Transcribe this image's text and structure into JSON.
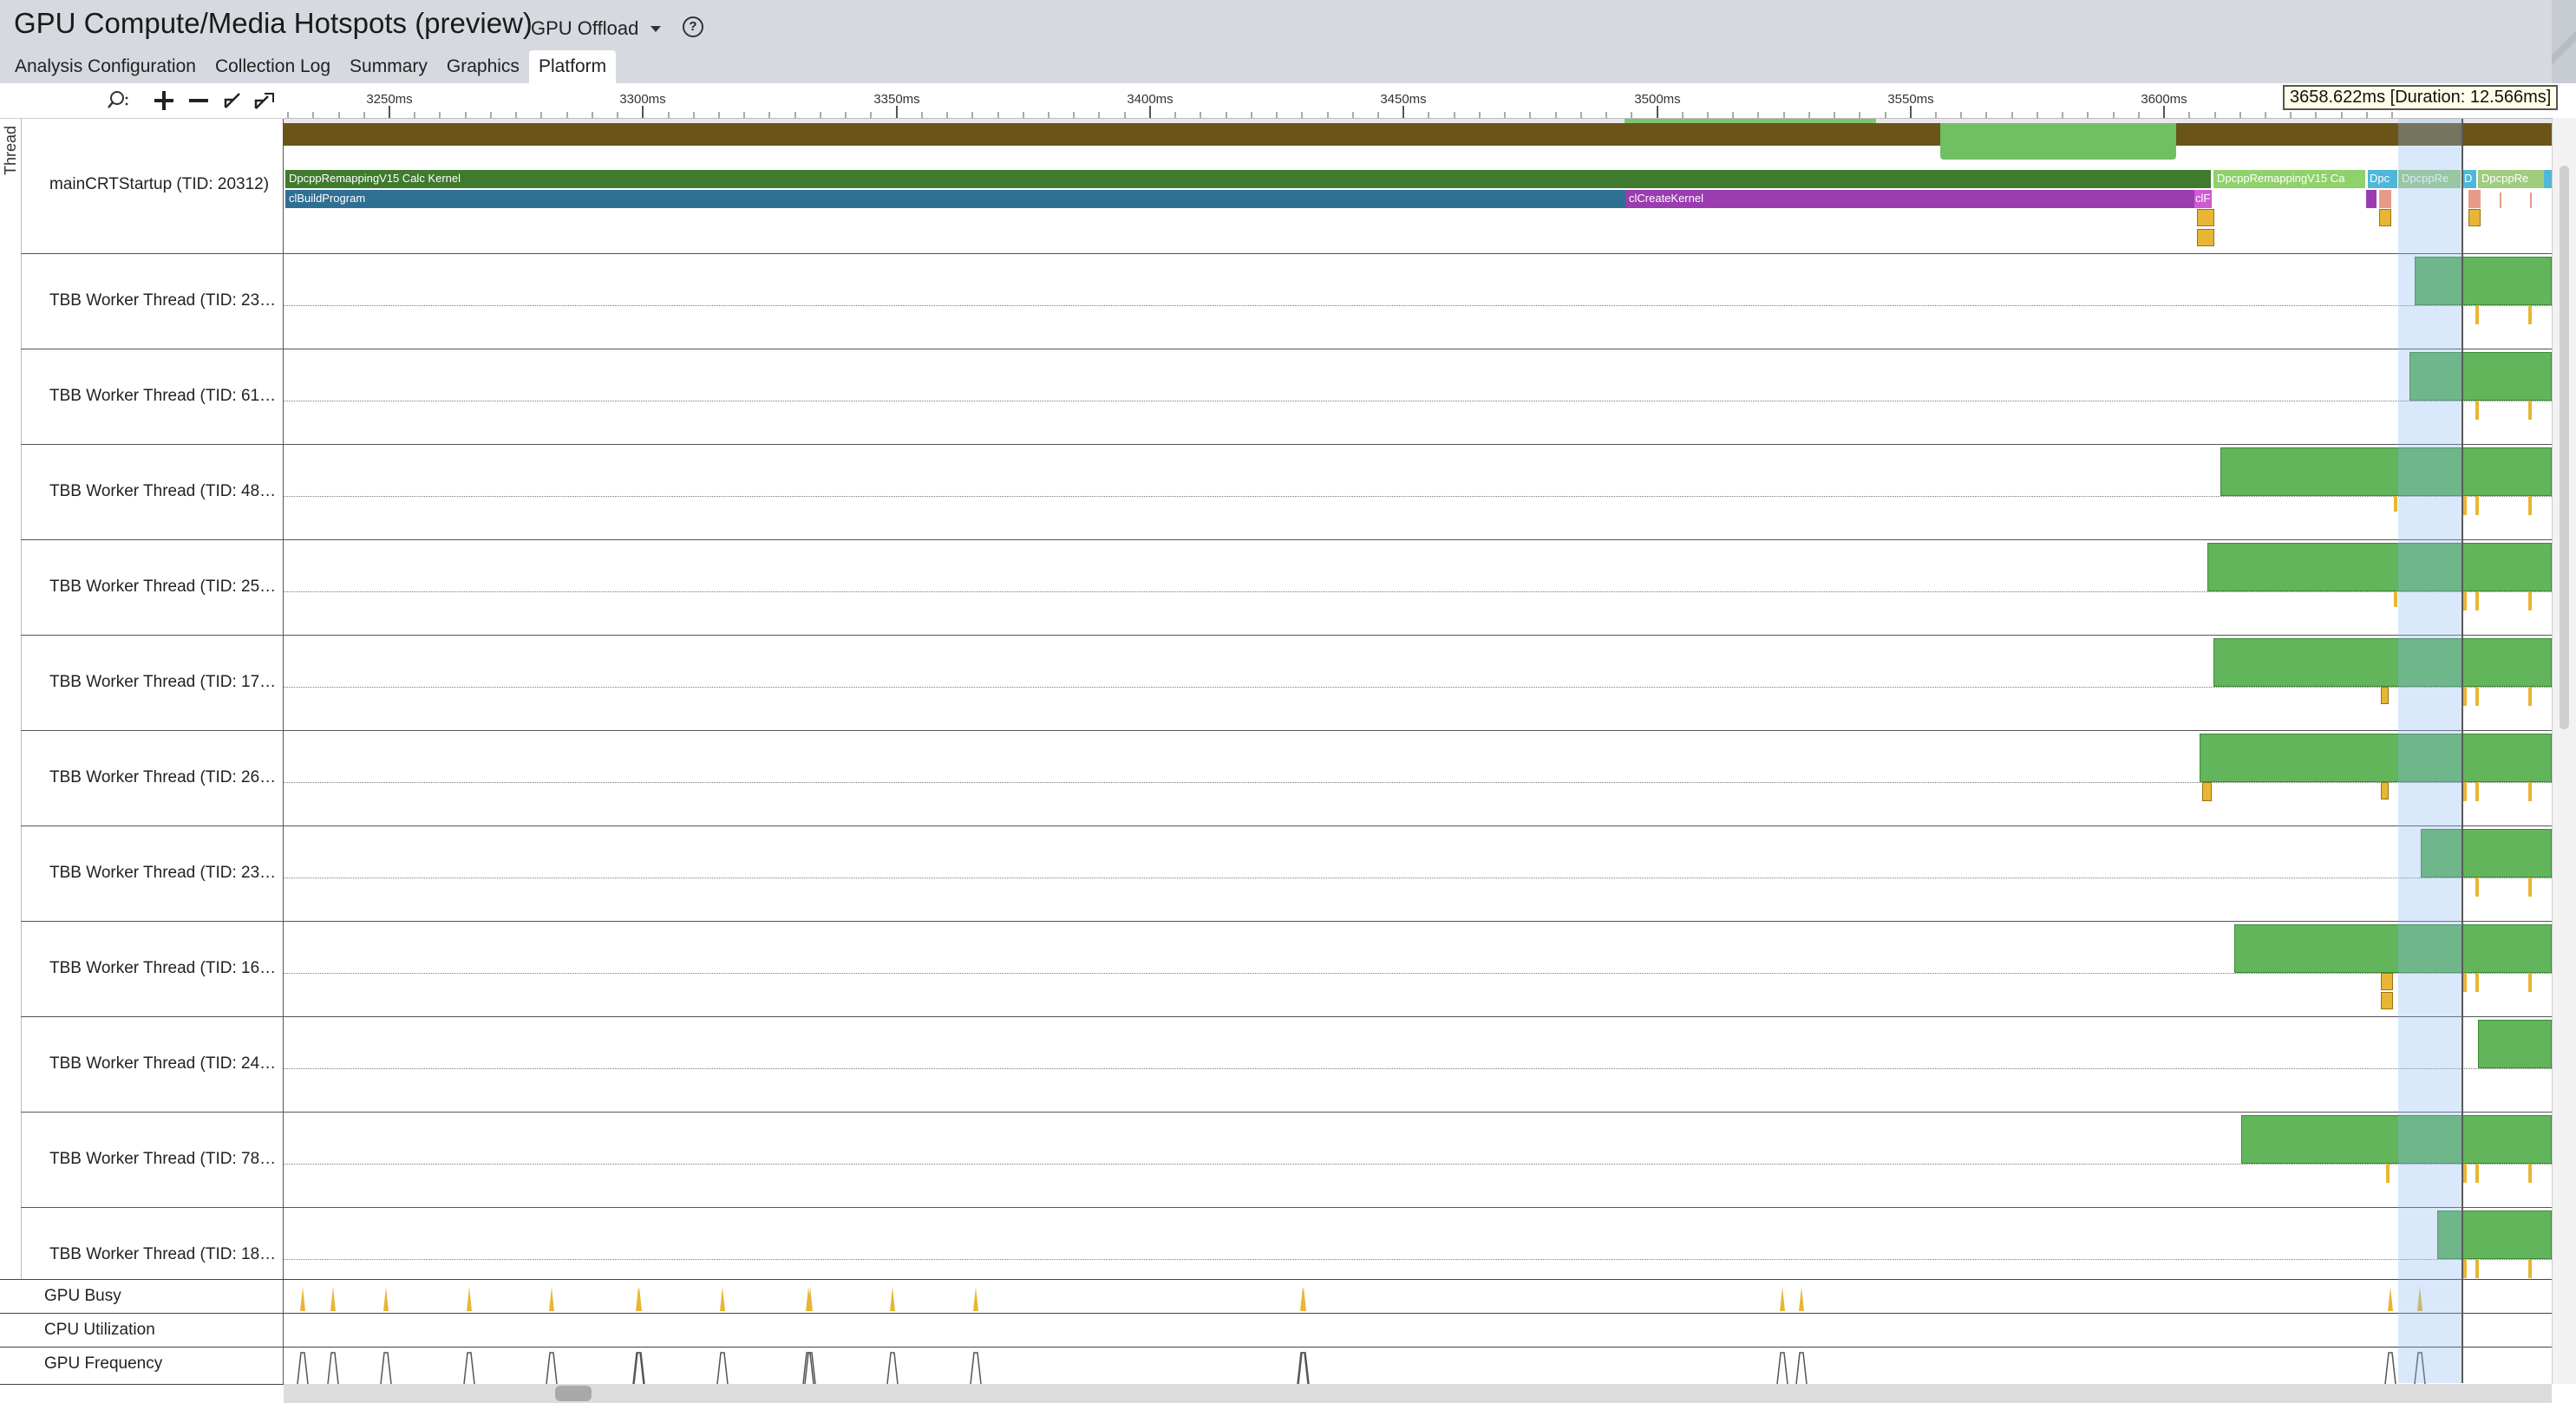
{
  "app": {
    "title": "GPU Compute/Media Hotspots (preview)",
    "mode": "GPU Offload",
    "help_glyph": "?"
  },
  "tabs": [
    {
      "label": "Analysis Configuration",
      "active": false
    },
    {
      "label": "Collection Log",
      "active": false
    },
    {
      "label": "Summary",
      "active": false
    },
    {
      "label": "Graphics",
      "active": false
    },
    {
      "label": "Platform",
      "active": true
    }
  ],
  "toolbar": {
    "icons": [
      "zoom-search-icon",
      "zoom-in-icon",
      "zoom-out-icon",
      "zoom-undo-icon",
      "zoom-reset-icon"
    ]
  },
  "timeline": {
    "ticks": [
      "3250ms",
      "3300ms",
      "3350ms",
      "3400ms",
      "3450ms",
      "3500ms",
      "3550ms",
      "3600ms"
    ],
    "cursor_tooltip": "3658.622ms [Duration: 12.566ms]",
    "section_label": "Thread"
  },
  "threads": [
    {
      "label": "mainCRTStartup (TID: 20312)",
      "main_bars": [
        {
          "text": "DpcppRemappingV15 Calc Kernel",
          "color": "#3f7a2e"
        },
        {
          "text": "clBuildProgram",
          "color": "#2f6f94"
        },
        {
          "text": "clCreateKernel",
          "color": "#9b3cb0"
        },
        {
          "text": "DpcppRemappingV15 Ca",
          "color": "#8fd16a"
        },
        {
          "text": "Dpc",
          "color": "#4fb7d9"
        },
        {
          "text": "DpcppRe",
          "color": "#9fcc7f"
        },
        {
          "text": "D",
          "color": "#4fb7d9"
        },
        {
          "text": "DpcppRe",
          "color": "#9fcc7f"
        },
        {
          "text": "clF",
          "color": "#d05ad6"
        }
      ]
    },
    {
      "label": "TBB Worker Thread (TID: 23…"
    },
    {
      "label": "TBB Worker Thread (TID: 61…"
    },
    {
      "label": "TBB Worker Thread (TID: 48…"
    },
    {
      "label": "TBB Worker Thread (TID: 25…"
    },
    {
      "label": "TBB Worker Thread (TID: 17…"
    },
    {
      "label": "TBB Worker Thread (TID: 26…"
    },
    {
      "label": "TBB Worker Thread (TID: 23…"
    },
    {
      "label": "TBB Worker Thread (TID: 16…"
    },
    {
      "label": "TBB Worker Thread (TID: 24…"
    },
    {
      "label": "TBB Worker Thread (TID: 78…"
    },
    {
      "label": "TBB Worker Thread (TID: 18…"
    }
  ],
  "bottom_rows": [
    {
      "label": "GPU Busy"
    },
    {
      "label": "CPU Utilization"
    },
    {
      "label": "GPU Frequency"
    }
  ],
  "colors": {
    "background": "#ffffff",
    "header": "#d6d9df",
    "thread_running": "#62b55a",
    "gpu_busy": "#e8b634",
    "selection": "#8cb9f0",
    "cpu_utilization_band": "#6b5418"
  }
}
